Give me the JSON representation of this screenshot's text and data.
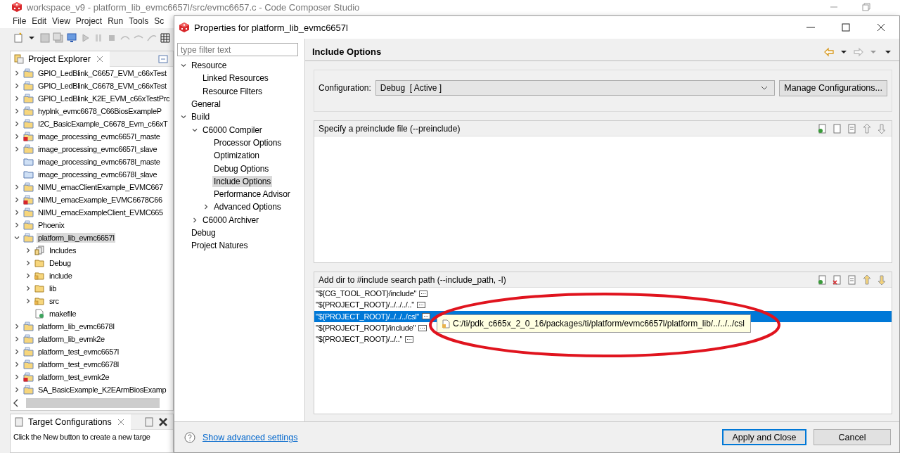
{
  "ide": {
    "title": "workspace_v9 - platform_lib_evmc6657l/src/evmc6657.c - Code Composer Studio",
    "menu": [
      "File",
      "Edit",
      "View",
      "Project",
      "Run",
      "Tools",
      "Sc"
    ],
    "project_explorer": {
      "title": "Project Explorer",
      "items": [
        {
          "label": "GPIO_LedBlink_C6657_EVM_c66xTest",
          "kind": "project",
          "expanded": false,
          "selected": false
        },
        {
          "label": "GPIO_LedBlink_C6678_EVM_c66xTest",
          "kind": "project",
          "expanded": false,
          "selected": false
        },
        {
          "label": "GPIO_LedBlink_K2E_EVM_c66xTestPrc",
          "kind": "project",
          "expanded": false,
          "selected": false
        },
        {
          "label": "hyplnk_evmc6678_C66BiosExampleP",
          "kind": "project",
          "expanded": false,
          "selected": false
        },
        {
          "label": "I2C_BasicExample_C6678_Evm_c66xT",
          "kind": "project",
          "expanded": false,
          "selected": false
        },
        {
          "label": "image_processing_evmc6657l_maste",
          "kind": "project_error",
          "expanded": false,
          "selected": false
        },
        {
          "label": "image_processing_evmc6657l_slave",
          "kind": "project",
          "expanded": false,
          "selected": false
        },
        {
          "label": "image_processing_evmc6678l_maste",
          "kind": "closed",
          "selected": false
        },
        {
          "label": "image_processing_evmc6678l_slave",
          "kind": "closed",
          "selected": false
        },
        {
          "label": "NIMU_emacClientExample_EVMC667",
          "kind": "project",
          "expanded": false,
          "selected": false
        },
        {
          "label": "NIMU_emacExample_EVMC6678C66",
          "kind": "project_error",
          "expanded": false,
          "selected": false
        },
        {
          "label": "NIMU_emacExampleClient_EVMC665",
          "kind": "project",
          "expanded": false,
          "selected": false
        },
        {
          "label": "Phoenix",
          "kind": "project",
          "expanded": false,
          "selected": false
        },
        {
          "label": "platform_lib_evmc6657l",
          "kind": "project",
          "expanded": true,
          "selected": true,
          "children": [
            {
              "label": "Includes",
              "kind": "includes",
              "expanded": false,
              "selected": false
            },
            {
              "label": "Debug",
              "kind": "folder",
              "expanded": false,
              "selected": false
            },
            {
              "label": "include",
              "kind": "source_folder",
              "expanded": false,
              "selected": false
            },
            {
              "label": "lib",
              "kind": "folder",
              "expanded": false,
              "selected": false
            },
            {
              "label": "src",
              "kind": "source_folder",
              "expanded": false,
              "selected": false
            },
            {
              "label": "makefile",
              "kind": "file",
              "selected": false
            }
          ]
        },
        {
          "label": "platform_lib_evmc6678l",
          "kind": "project",
          "expanded": false,
          "selected": false
        },
        {
          "label": "platform_lib_evmk2e",
          "kind": "project",
          "expanded": false,
          "selected": false
        },
        {
          "label": "platform_test_evmc6657l",
          "kind": "project",
          "expanded": false,
          "selected": false
        },
        {
          "label": "platform_test_evmc6678l",
          "kind": "project",
          "expanded": false,
          "selected": false
        },
        {
          "label": "platform_test_evmk2e",
          "kind": "project_error",
          "expanded": false,
          "selected": false
        },
        {
          "label": "SA_BasicExample_K2EArmBiosExamp",
          "kind": "project",
          "expanded": false,
          "selected": false
        }
      ]
    },
    "target_configurations": {
      "title": "Target Configurations",
      "message": "Click the New button to create a new targe"
    }
  },
  "dialog": {
    "title": "Properties for platform_lib_evmc6657l",
    "filter": {
      "placeholder": "type filter text"
    },
    "tree": [
      {
        "label": "Resource",
        "expanded": true,
        "selected": false,
        "children": [
          {
            "label": "Linked Resources",
            "selected": false
          },
          {
            "label": "Resource Filters",
            "selected": false
          }
        ]
      },
      {
        "label": "General",
        "selected": false
      },
      {
        "label": "Build",
        "expanded": true,
        "selected": false,
        "children": [
          {
            "label": "C6000 Compiler",
            "expanded": true,
            "selected": false,
            "children": [
              {
                "label": "Processor Options",
                "selected": false
              },
              {
                "label": "Optimization",
                "selected": false
              },
              {
                "label": "Debug Options",
                "selected": false
              },
              {
                "label": "Include Options",
                "selected": true
              },
              {
                "label": "Performance Advisor",
                "selected": false
              },
              {
                "label": "Advanced Options",
                "expanded": false,
                "selected": false
              }
            ]
          },
          {
            "label": "C6000 Archiver",
            "expanded": false,
            "selected": false
          }
        ]
      },
      {
        "label": "Debug",
        "selected": false
      },
      {
        "label": "Project Natures",
        "selected": false
      }
    ],
    "page_title": "Include Options",
    "configuration": {
      "label": "Configuration:",
      "value": "Debug  [ Active ]",
      "button": "Manage Configurations..."
    },
    "preinclude": {
      "title": "Specify a preinclude file (--preinclude)"
    },
    "include_path": {
      "title": "Add dir to #include search path (--include_path, -I)",
      "entries": [
        {
          "text": "\"${CG_TOOL_ROOT}/include\"",
          "selected": false
        },
        {
          "text": "\"${PROJECT_ROOT}/../../../..\"",
          "selected": false
        },
        {
          "text": "\"${PROJECT_ROOT}/../../../csl\"",
          "selected": true
        },
        {
          "text": "\"${PROJECT_ROOT}/include\"",
          "selected": false
        },
        {
          "text": "\"${PROJECT_ROOT}/../..\"",
          "selected": false
        }
      ],
      "tooltip": "C:/ti/pdk_c665x_2_0_16/packages/ti/platform/evmc6657l/platform_lib/../../../csl"
    },
    "help_link": "Show advanced settings",
    "buttons": [
      {
        "label": "Apply and Close",
        "kind": "default"
      },
      {
        "label": "Cancel",
        "kind": "normal"
      }
    ]
  }
}
